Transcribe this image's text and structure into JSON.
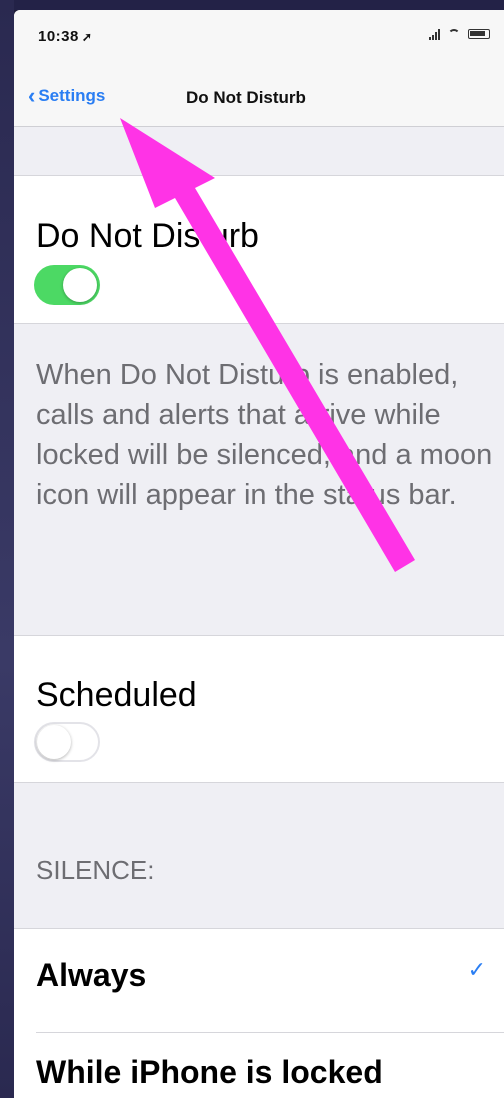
{
  "status_bar": {
    "time": "10:38",
    "location_glyph": "➚"
  },
  "nav": {
    "back_label": "Settings",
    "title": "Do Not Disturb"
  },
  "dnd": {
    "label": "Do Not Disturb",
    "enabled": true,
    "description": "When Do Not Disturb is enabled, calls and alerts that arrive while locked will be silenced, and a moon icon will appear in the status bar."
  },
  "scheduled": {
    "label": "Scheduled",
    "enabled": false
  },
  "silence": {
    "header": "SILENCE:",
    "options": [
      {
        "label": "Always",
        "selected": true
      },
      {
        "label": "While iPhone is locked",
        "selected": false
      }
    ]
  },
  "colors": {
    "accent": "#2a7ef3",
    "toggle_on": "#4cd964",
    "annotation_arrow": "#ff33e6"
  },
  "icons": [
    "location-arrow-icon",
    "signal-icon",
    "wifi-icon",
    "battery-icon",
    "chevron-left-icon",
    "checkmark-icon"
  ]
}
